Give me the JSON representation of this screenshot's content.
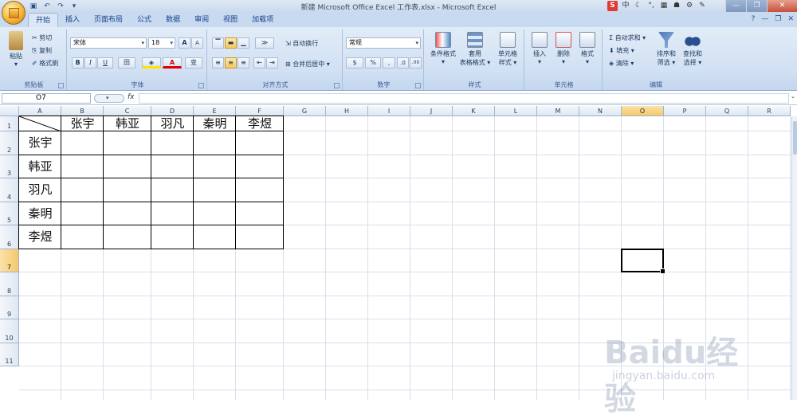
{
  "window": {
    "title": "新建 Microsoft Office Excel 工作表.xlsx - Microsoft Excel"
  },
  "title_icons": [
    "中",
    "☾",
    "°,",
    "▦",
    "☗",
    "⚙",
    "✎"
  ],
  "tabs": [
    "开始",
    "插入",
    "页面布局",
    "公式",
    "数据",
    "审阅",
    "视图",
    "加载项"
  ],
  "clipboard": {
    "paste": "粘贴",
    "cut": "剪切",
    "copy": "复制",
    "format_painter": "格式刷",
    "label": "剪贴板"
  },
  "font": {
    "name": "宋体",
    "size": "18",
    "grow": "A",
    "shrink": "A",
    "bold": "B",
    "italic": "I",
    "underline": "U",
    "border": "田",
    "fill": "◈",
    "color": "A",
    "phonetic": "变",
    "label": "字体"
  },
  "alignment": {
    "wrap": "自动换行",
    "merge": "合并后居中",
    "label": "对齐方式"
  },
  "number": {
    "format": "常规",
    "currency": "$",
    "percent": "%",
    "comma": ",",
    "inc": ".0",
    "dec": ".00",
    "label": "数字"
  },
  "styles": {
    "conditional": "条件格式",
    "table1": "套用",
    "table2": "表格格式",
    "cell1": "单元格",
    "cell2": "样式",
    "label": "样式"
  },
  "cells": {
    "insert": "插入",
    "delete": "删除",
    "format": "格式",
    "label": "单元格"
  },
  "editing": {
    "autosum": "自动求和",
    "fill": "填充",
    "clear": "清除",
    "sort1": "排序和",
    "sort2": "筛选",
    "find1": "查找和",
    "find2": "选择",
    "label": "编辑"
  },
  "formula_bar": {
    "name_box": "O7",
    "fx": "fx",
    "formula": ""
  },
  "columns": [
    "A",
    "B",
    "C",
    "D",
    "E",
    "F",
    "G",
    "H",
    "I",
    "J",
    "K",
    "L",
    "M",
    "N",
    "O",
    "P",
    "Q",
    "R"
  ],
  "rows": [
    "1",
    "2",
    "3",
    "4",
    "5",
    "6",
    "7",
    "8",
    "9",
    "10",
    "11"
  ],
  "selected_cell": "O7",
  "table": {
    "col_headers": [
      "张宇",
      "韩亚",
      "羽凡",
      "秦明",
      "李煜"
    ],
    "row_headers": [
      "张宇",
      "韩亚",
      "羽凡",
      "秦明",
      "李煜"
    ]
  },
  "watermark": {
    "text": "Baidu经验",
    "sub": "jingyan.baidu.com"
  }
}
